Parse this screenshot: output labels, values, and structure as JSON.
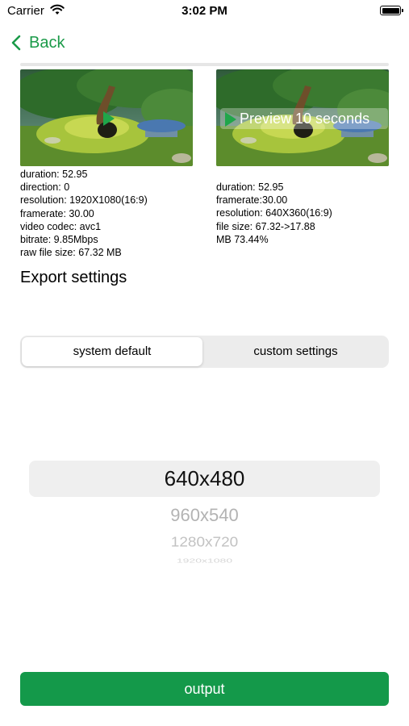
{
  "status_bar": {
    "carrier": "Carrier",
    "time": "3:02 PM"
  },
  "nav": {
    "back_label": "Back"
  },
  "preview": {
    "label": "Preview 10 seconds"
  },
  "source_info": [
    "duration: 52.95",
    "direction: 0",
    "resolution: 1920X1080(16:9)",
    "framerate: 30.00",
    "video codec: avc1",
    "bitrate: 9.85Mbps",
    "raw file size: 67.32 MB"
  ],
  "output_info": [
    "duration: 52.95",
    "framerate:30.00",
    "resolution: 640X360(16:9)",
    "file size: 67.32->17.88",
    "MB 73.44%"
  ],
  "export_settings": {
    "heading": "Export settings"
  },
  "mode_selector": {
    "options": [
      "system default",
      "custom settings"
    ],
    "selected": "system default"
  },
  "resolution_picker": {
    "options": [
      "640x480",
      "960x540",
      "1280x720",
      "1920x1080"
    ],
    "selected": "640x480"
  },
  "output_button": {
    "label": "output"
  },
  "colors": {
    "accent": "#14994a",
    "back_link": "#1a9a48",
    "preview_play": "#1fa64a"
  }
}
